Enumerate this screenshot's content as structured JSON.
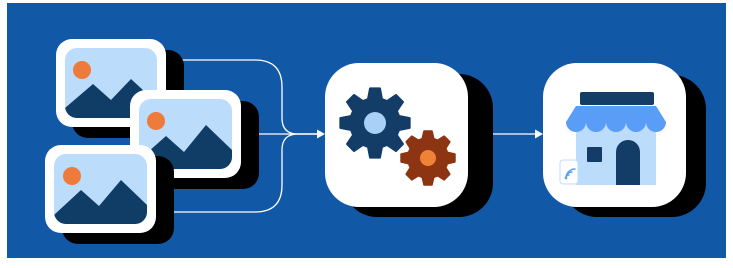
{
  "colors": {
    "page_bg": "#ffffff",
    "banner_bg": "#1158a7",
    "card_white": "#ffffff",
    "card_shadow": "#000000",
    "photo_sky": "#bcdcfb",
    "photo_mountain": "#0f3d66",
    "photo_sun": "#ee7a3b",
    "arrow": "#ffffff",
    "gear_large": "#133c67",
    "gear_large_hub": "#a9d1f7",
    "gear_small": "#8d3413",
    "gear_small_hub": "#f08238",
    "store_wall": "#bcdcfb",
    "store_awning": "#5a9df6",
    "store_sign": "#133c67",
    "store_door": "#133c67",
    "store_window": "#133c67",
    "wifi_badge_bg": "#ffffff",
    "wifi_badge_icon": "#5a9df6"
  },
  "diagram": {
    "sources": [
      {
        "id": "image-card-1",
        "icon": "image-icon"
      },
      {
        "id": "image-card-2",
        "icon": "image-icon"
      },
      {
        "id": "image-card-3",
        "icon": "image-icon"
      }
    ],
    "process": {
      "id": "processing-card",
      "icon": "gears-icon"
    },
    "destination": {
      "id": "store-card",
      "icon": "storefront-icon",
      "badge_icon": "contactless-icon"
    }
  }
}
